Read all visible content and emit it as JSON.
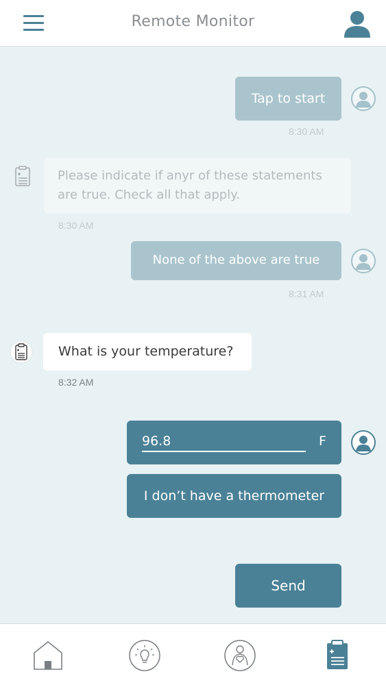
{
  "header": {
    "title": "Remote Monitor",
    "menu_icon": "hamburger-menu-icon",
    "profile_icon": "user-profile-icon"
  },
  "messages": [
    {
      "sender": "user",
      "text": "Tap to start",
      "time": "8:30 AM",
      "faded": true
    },
    {
      "sender": "bot",
      "text": "Please indicate if anyr of these statements are true. Check all that apply.",
      "time": "8:30 AM",
      "faded": true
    },
    {
      "sender": "user",
      "text": "None of the above are true",
      "time": "8:31 AM",
      "faded": true
    },
    {
      "sender": "bot",
      "text": "What is your temperature?",
      "time": "8:32 AM",
      "faded": false
    }
  ],
  "temperature": {
    "value": "96.8",
    "unit": "F"
  },
  "no_thermometer_label": "I don’t have a thermometer",
  "send_label": "Send",
  "tabs": [
    {
      "name": "home",
      "icon": "home-icon"
    },
    {
      "name": "tips",
      "icon": "lightbulb-icon"
    },
    {
      "name": "care",
      "icon": "person-heart-icon"
    },
    {
      "name": "survey",
      "icon": "clipboard-icon",
      "active": true
    }
  ],
  "colors": {
    "primary": "#4a8196",
    "background": "#e8f1f3",
    "faded_user_bubble": "#a9c4cc"
  }
}
